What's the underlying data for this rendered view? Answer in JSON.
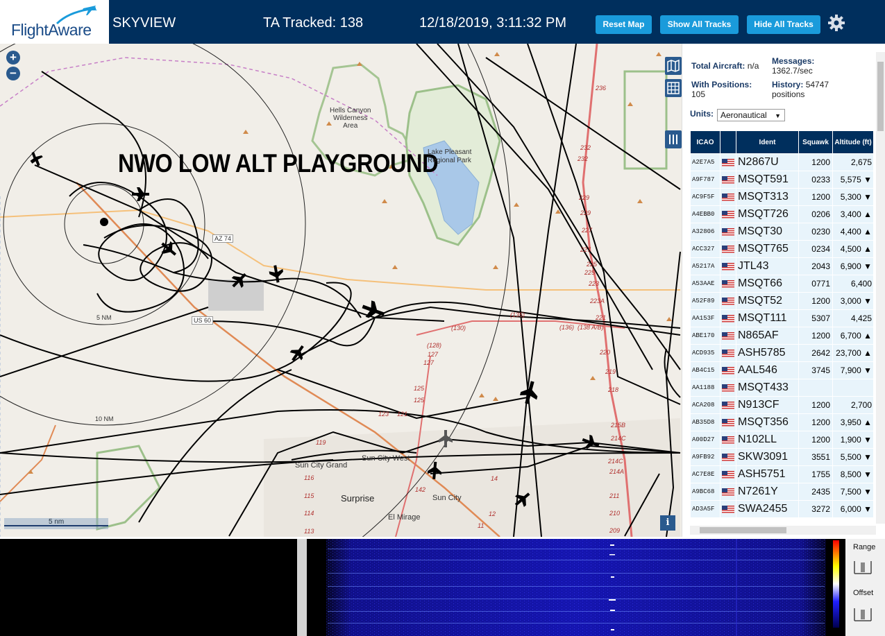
{
  "header": {
    "logo_text": "FlightAware",
    "app_title": "SKYVIEW",
    "ta_tracked": "TA Tracked: 138",
    "datetime": "12/18/2019, 3:11:32 PM",
    "buttons": {
      "reset_map": "Reset Map",
      "show_all_tracks": "Show All Tracks",
      "hide_all_tracks": "Hide All Tracks"
    },
    "settings_icon": "gear-icon"
  },
  "map": {
    "overlay_title": "NWO LOW ALT PLAYGROUND",
    "zoom_in": "+",
    "zoom_out": "−",
    "scale_label": "5 nm",
    "info_label": "i",
    "range_rings": [
      "5 NM",
      "10 NM"
    ],
    "labels": {
      "hells_canyon": "Hells Canyon\nWilderness\nArea",
      "lake_pleasant": "Lake Pleasant\nRegional Park",
      "sun_city_grand": "Sun City Grand",
      "sun_city_west": "Sun City West",
      "surprise": "Surprise",
      "sun_city": "Sun City",
      "el_mirage": "El Mirage",
      "az74": "AZ 74",
      "us60": "US 60"
    },
    "route_numbers": [
      "236",
      "232",
      "232",
      "229",
      "229",
      "227",
      "227",
      "225",
      "225",
      "223",
      "223A",
      "221",
      "220",
      "219",
      "218",
      "215B",
      "214C",
      "214C",
      "214A",
      "211",
      "210",
      "209",
      "(135)",
      "(136)",
      "(138 A/B)",
      "(130)",
      "(128)",
      "127",
      "127",
      "125",
      "125",
      "123",
      "121",
      "119",
      "116",
      "115",
      "114",
      "113",
      "142",
      "14",
      "12",
      "11"
    ]
  },
  "sidebar": {
    "total_aircraft_label": "Total Aircraft:",
    "total_aircraft_value": "n/a",
    "messages_label": "Messages:",
    "messages_value": "1362.7/sec",
    "with_positions_label": "With Positions:",
    "with_positions_value": "105",
    "history_label": "History:",
    "history_value": "54747",
    "history_unit": "positions",
    "units_label": "Units:",
    "units_value": "Aeronautical",
    "columns": [
      "ICAO",
      "",
      "Ident",
      "Squawk",
      "Altitude (ft)"
    ],
    "rows": [
      {
        "icao": "A2E7A5",
        "ident": "N2867U",
        "squawk": "1200",
        "alt": "2,675",
        "trend": ""
      },
      {
        "icao": "A9F787",
        "ident": "MSQT591",
        "squawk": "0233",
        "alt": "5,575",
        "trend": "▼"
      },
      {
        "icao": "AC9F5F",
        "ident": "MSQT313",
        "squawk": "1200",
        "alt": "5,300",
        "trend": "▼"
      },
      {
        "icao": "A4EBB0",
        "ident": "MSQT726",
        "squawk": "0206",
        "alt": "3,400",
        "trend": "▲"
      },
      {
        "icao": "A32806",
        "ident": "MSQT30",
        "squawk": "0230",
        "alt": "4,400",
        "trend": "▲"
      },
      {
        "icao": "ACC327",
        "ident": "MSQT765",
        "squawk": "0234",
        "alt": "4,500",
        "trend": "▲"
      },
      {
        "icao": "A5217A",
        "ident": "JTL43",
        "squawk": "2043",
        "alt": "6,900",
        "trend": "▼"
      },
      {
        "icao": "A53AAE",
        "ident": "MSQT66",
        "squawk": "0771",
        "alt": "6,400",
        "trend": ""
      },
      {
        "icao": "A52F89",
        "ident": "MSQT52",
        "squawk": "1200",
        "alt": "3,000",
        "trend": "▼"
      },
      {
        "icao": "AA153F",
        "ident": "MSQT111",
        "squawk": "5307",
        "alt": "4,425",
        "trend": ""
      },
      {
        "icao": "ABE170",
        "ident": "N865AF",
        "squawk": "1200",
        "alt": "6,700",
        "trend": "▲"
      },
      {
        "icao": "ACD935",
        "ident": "ASH5785",
        "squawk": "2642",
        "alt": "23,700",
        "trend": "▲"
      },
      {
        "icao": "AB4C15",
        "ident": "AAL546",
        "squawk": "3745",
        "alt": "7,900",
        "trend": "▼"
      },
      {
        "icao": "AA1188",
        "ident": "MSQT433",
        "squawk": "",
        "alt": "",
        "trend": ""
      },
      {
        "icao": "ACA208",
        "ident": "N913CF",
        "squawk": "1200",
        "alt": "2,700",
        "trend": ""
      },
      {
        "icao": "AB35D8",
        "ident": "MSQT356",
        "squawk": "1200",
        "alt": "3,950",
        "trend": "▲"
      },
      {
        "icao": "A00D27",
        "ident": "N102LL",
        "squawk": "1200",
        "alt": "1,900",
        "trend": "▼"
      },
      {
        "icao": "A9FB92",
        "ident": "SKW3091",
        "squawk": "3551",
        "alt": "5,500",
        "trend": "▼"
      },
      {
        "icao": "AC7E8E",
        "ident": "ASH5751",
        "squawk": "1755",
        "alt": "8,500",
        "trend": "▼"
      },
      {
        "icao": "A9BC68",
        "ident": "N7261Y",
        "squawk": "2435",
        "alt": "7,500",
        "trend": "▼"
      },
      {
        "icao": "AD3A5F",
        "ident": "SWA2455",
        "squawk": "3272",
        "alt": "6,000",
        "trend": "▼"
      }
    ]
  },
  "waterfall": {
    "range_label": "Range",
    "offset_label": "Offset"
  },
  "colors": {
    "header_bg": "#002f5d",
    "button_bg": "#1a9bdb",
    "map_bg": "#f1eee8",
    "table_header": "#002f5d",
    "row_bg": "#e8f4fb"
  }
}
